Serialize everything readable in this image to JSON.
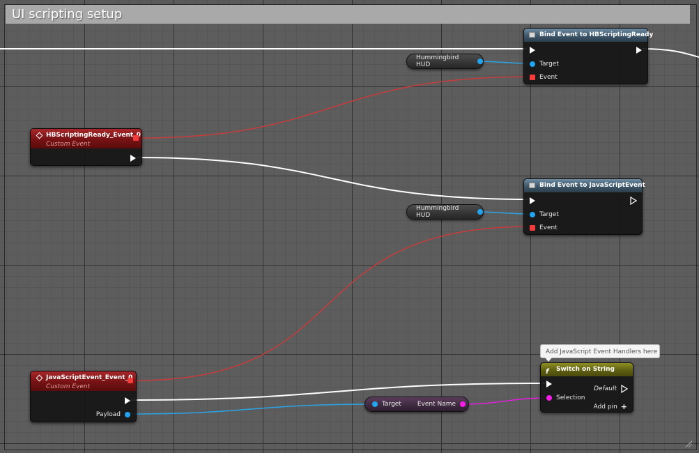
{
  "comment": {
    "title": "UI scripting setup"
  },
  "nodes": {
    "bind_hb_ready": {
      "title": "Bind Event to HBScriptingReady",
      "pins": {
        "target": "Target",
        "event": "Event"
      }
    },
    "bind_js_event": {
      "title": "Bind Event to JavaScriptEvent",
      "pins": {
        "target": "Target",
        "event": "Event"
      }
    },
    "hb_ready_event": {
      "title": "HBScriptingReady_Event_0",
      "subtitle": "Custom Event"
    },
    "js_event": {
      "title": "JavaScriptEvent_Event_0",
      "subtitle": "Custom Event",
      "pins": {
        "payload": "Payload"
      }
    },
    "switch_string": {
      "title": "Switch on String",
      "comment_bubble": "Add JavaScript Event Handlers here",
      "pins": {
        "selection": "Selection",
        "default": "Default",
        "add_pin": "Add pin"
      }
    },
    "hud_var_1": {
      "label": "Hummingbird HUD"
    },
    "hud_var_2": {
      "label": "Hummingbird HUD"
    },
    "event_name_getter": {
      "target": "Target",
      "output": "Event Name"
    }
  },
  "colors": {
    "exec_wire": "#ffffff",
    "delegate_wire": "#c83c3c",
    "object_wire": "#2aa4e6",
    "string_wire": "#e61ee0"
  },
  "icons": {
    "function_icon": "function-icon",
    "event_icon": "event-diamond-icon",
    "switch_icon": "switch-icon"
  }
}
